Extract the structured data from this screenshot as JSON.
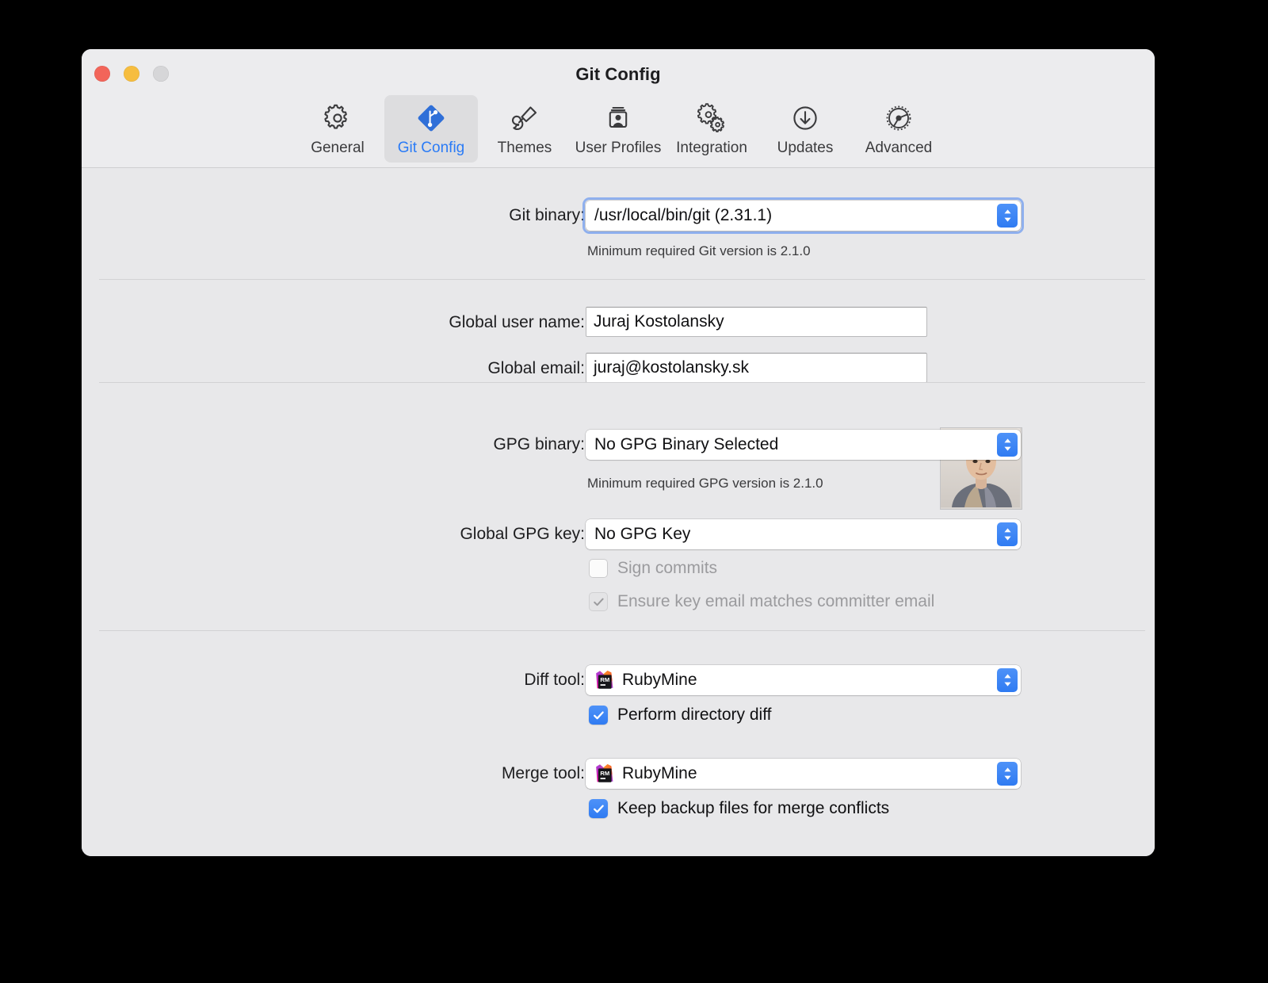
{
  "window": {
    "title": "Git Config",
    "controls": [
      {
        "name": "close",
        "color": "#f2655a"
      },
      {
        "name": "minimize",
        "color": "#f6bd3f"
      },
      {
        "name": "zoom",
        "color": "#d6d6d8"
      }
    ]
  },
  "toolbar": {
    "selected": "Git Config",
    "accent": "#2a7bf6",
    "items": [
      {
        "label": "General",
        "icon": "gear-icon"
      },
      {
        "label": "Git Config",
        "icon": "git-diamond-icon"
      },
      {
        "label": "Themes",
        "icon": "paintbrush-icon"
      },
      {
        "label": "User Profiles",
        "icon": "user-card-icon"
      },
      {
        "label": "Integration",
        "icon": "two-gears-icon"
      },
      {
        "label": "Updates",
        "icon": "download-circle-icon"
      },
      {
        "label": "Advanced",
        "icon": "cog-wheel-icon"
      }
    ]
  },
  "sections": {
    "git_binary": {
      "label": "Git binary:",
      "value": "/usr/local/bin/git (2.31.1)",
      "hint": "Minimum required Git version is 2.1.0",
      "focused": true
    },
    "identity": {
      "user_name_label": "Global user name:",
      "user_name_value": "Juraj Kostolansky",
      "email_label": "Global email:",
      "email_value": "juraj@kostolansky.sk",
      "avatar_alt": "user-avatar-photo"
    },
    "gpg": {
      "binary_label": "GPG binary:",
      "binary_value": "No GPG Binary Selected",
      "binary_hint": "Minimum required GPG version is 2.1.0",
      "key_label": "Global GPG key:",
      "key_value": "No GPG Key",
      "sign_commits_label": "Sign commits",
      "sign_commits_checked": false,
      "sign_commits_enabled": false,
      "ensure_email_label": "Ensure key email matches committer email",
      "ensure_email_checked": true,
      "ensure_email_enabled": false
    },
    "tools": {
      "diff_label": "Diff tool:",
      "diff_value": "RubyMine",
      "diff_icon": "rubymine-app-icon",
      "directory_diff_label": "Perform directory diff",
      "directory_diff_checked": true,
      "merge_label": "Merge tool:",
      "merge_value": "RubyMine",
      "merge_icon": "rubymine-app-icon",
      "keep_backup_label": "Keep backup files for merge conflicts",
      "keep_backup_checked": true
    }
  }
}
